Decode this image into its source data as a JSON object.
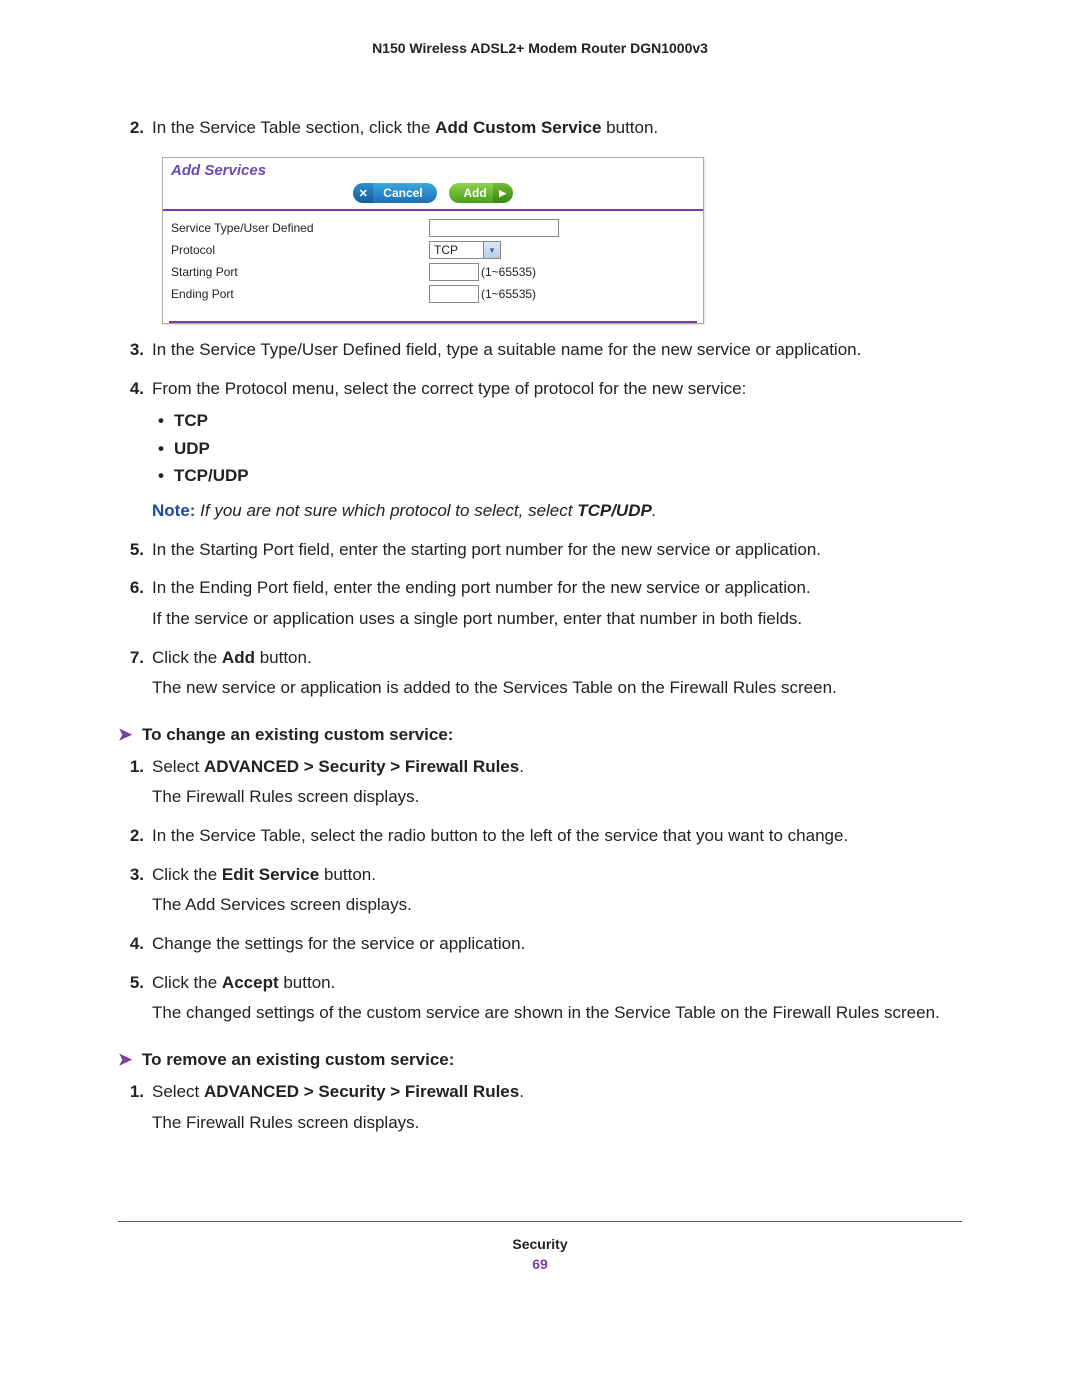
{
  "header": "N150 Wireless ADSL2+ Modem Router DGN1000v3",
  "main_steps": {
    "s2": {
      "pre": "In the Service Table section, click the ",
      "bold": "Add Custom Service",
      "post": " button."
    },
    "s3": "In the Service Type/User Defined field, type a suitable name for the new service or application.",
    "s4": {
      "lead": "From the Protocol menu, select the correct type of protocol for the new service:",
      "opts": [
        "TCP",
        "UDP",
        "TCP/UDP"
      ],
      "note_label": "Note:",
      "note_body_pre": " If you are not sure which protocol to select, select ",
      "note_bold": "TCP/UDP",
      "note_post": "."
    },
    "s5": "In the Starting Port field, enter the starting port number for the new service or application.",
    "s6": {
      "a": "In the Ending Port field, enter the ending port number for the new service or application.",
      "b": "If the service or application uses a single port number, enter that number in both fields."
    },
    "s7": {
      "a_pre": "Click the ",
      "a_bold": "Add",
      "a_post": " button.",
      "b": "The new service or application is added to the Services Table on the Firewall Rules screen."
    }
  },
  "proc_change": {
    "title": "To change an existing custom service:",
    "steps": {
      "s1": {
        "a_pre": "Select ",
        "a_bold": "ADVANCED > Security > Firewall Rules",
        "a_post": ".",
        "b": "The Firewall Rules screen displays."
      },
      "s2": "In the Service Table, select the radio button to the left of the service that you want to change.",
      "s3": {
        "a_pre": "Click the ",
        "a_bold": "Edit Service",
        "a_post": " button.",
        "b": "The Add Services screen displays."
      },
      "s4": "Change the settings for the service or application.",
      "s5": {
        "a_pre": "Click the ",
        "a_bold": "Accept",
        "a_post": " button.",
        "b": "The changed settings of the custom service are shown in the Service Table on the Firewall Rules screen."
      }
    }
  },
  "proc_remove": {
    "title": "To remove an existing custom service:",
    "steps": {
      "s1": {
        "a_pre": "Select ",
        "a_bold": "ADVANCED > Security > Firewall Rules",
        "a_post": ".",
        "b": "The Firewall Rules screen displays."
      }
    }
  },
  "shot": {
    "title": "Add Services",
    "cancel": "Cancel",
    "add": "Add",
    "rows": {
      "service_type": "Service Type/User Defined",
      "protocol": "Protocol",
      "starting_port": "Starting Port",
      "ending_port": "Ending Port"
    },
    "protocol_value": "TCP",
    "port_range": "(1~65535)"
  },
  "footer": {
    "section": "Security",
    "page": "69"
  }
}
